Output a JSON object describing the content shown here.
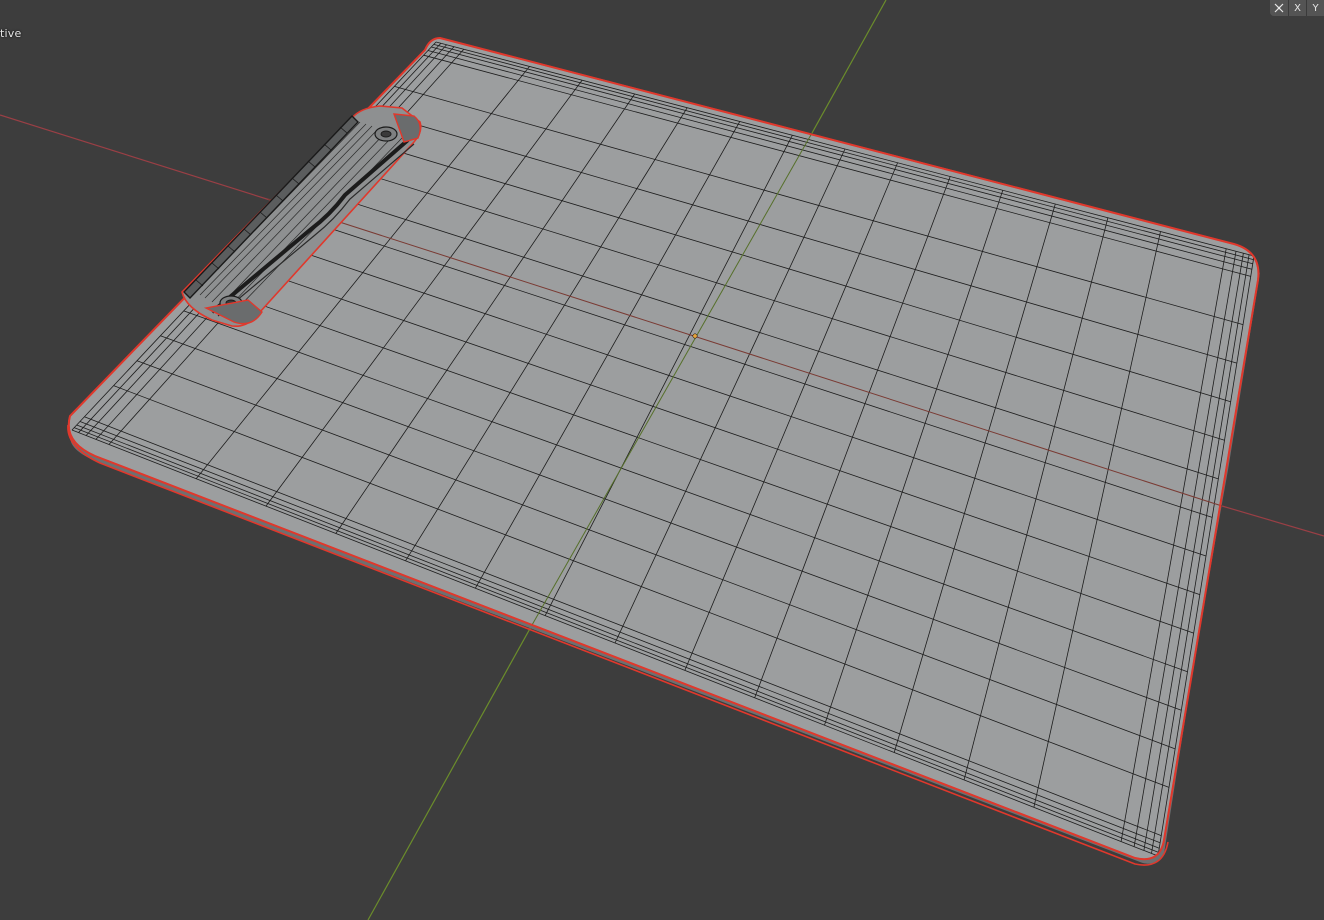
{
  "viewport": {
    "mode_label": "tive",
    "background_color": "#3d3d3d"
  },
  "toolbar": {
    "mirror_icon": "mirror-axis-icon",
    "axis_x_label": "X",
    "axis_y_label": "Y"
  },
  "scene": {
    "object": "clipboard",
    "display": "wireframe-over-solid",
    "selection_outline_color": "#e0382c",
    "mesh_face_color": "#9b9d9e",
    "wire_color": "#1c1c1c",
    "x_axis_color": "#9a3f45",
    "y_axis_color": "#6b8d2b",
    "origin_color": "#e8a33a"
  }
}
